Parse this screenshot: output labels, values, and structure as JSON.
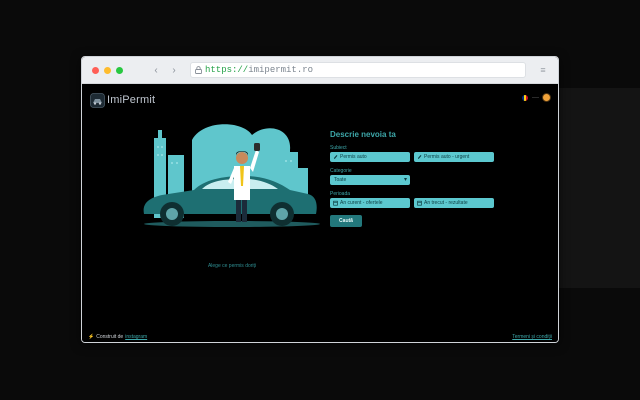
{
  "browser": {
    "url_protocol": "https://",
    "url_host": "imipermit.ro",
    "back_icon": "chevron-left-icon",
    "forward_icon": "chevron-right-icon",
    "back_glyph": "‹",
    "forward_glyph": "›",
    "menu_glyph": "≡"
  },
  "header": {
    "brand": "ImiPermit",
    "language_separator": "—"
  },
  "illustration": {
    "caption": "Alege ce permis doriți"
  },
  "form": {
    "title": "Descrie nevoia ta",
    "subject_label": "Subiect",
    "subject_options": [
      "Permis auto",
      "Permis auto - urgent"
    ],
    "category_label": "Categorie",
    "category_value": "Toate",
    "category_chevron": "▾",
    "period_label": "Perioada",
    "period_options": [
      "An curent - ofertele",
      "An trecut - rezultate"
    ],
    "submit_label": "Caută"
  },
  "footer": {
    "built_prefix": "Construit de",
    "built_link": "instagram",
    "right_link": "Termeni și condiții"
  },
  "colors": {
    "accent": "#3da7a9",
    "pill": "#5cc8cf",
    "button": "#23787c"
  }
}
